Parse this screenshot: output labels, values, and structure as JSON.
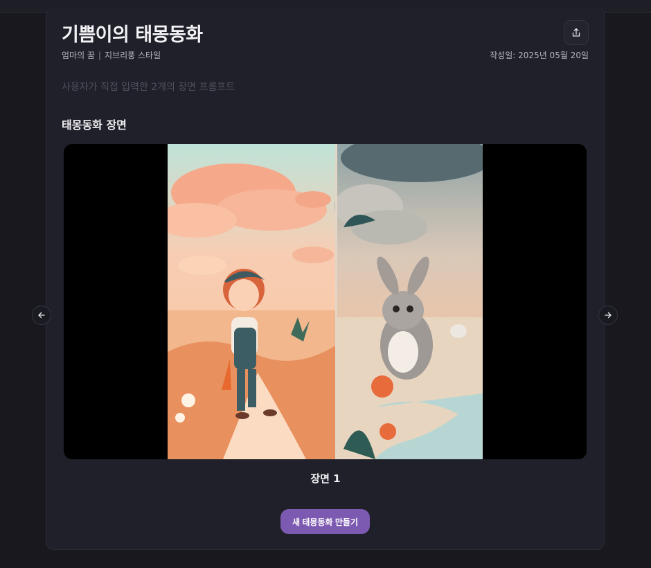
{
  "story": {
    "title": "기쁨이의 태몽동화",
    "author": "엄마의 꿈",
    "style": "지브리풍 스타일",
    "separator": "|",
    "created_label": "작성일: 2025년 05월 20일",
    "prompt_note": "사용자가 직접 입력한 2개의 장면 프롬프트"
  },
  "scenes": {
    "section_title": "태몽동화 장면",
    "current_label": "장면 1"
  },
  "actions": {
    "create_new_label": "새 태몽동화 만들기"
  },
  "icons": {
    "share": "share-icon",
    "prev": "arrow-left-icon",
    "next": "arrow-right-icon"
  },
  "colors": {
    "background": "#18181e",
    "card": "#1f2029",
    "accent": "#7d5ab1"
  }
}
